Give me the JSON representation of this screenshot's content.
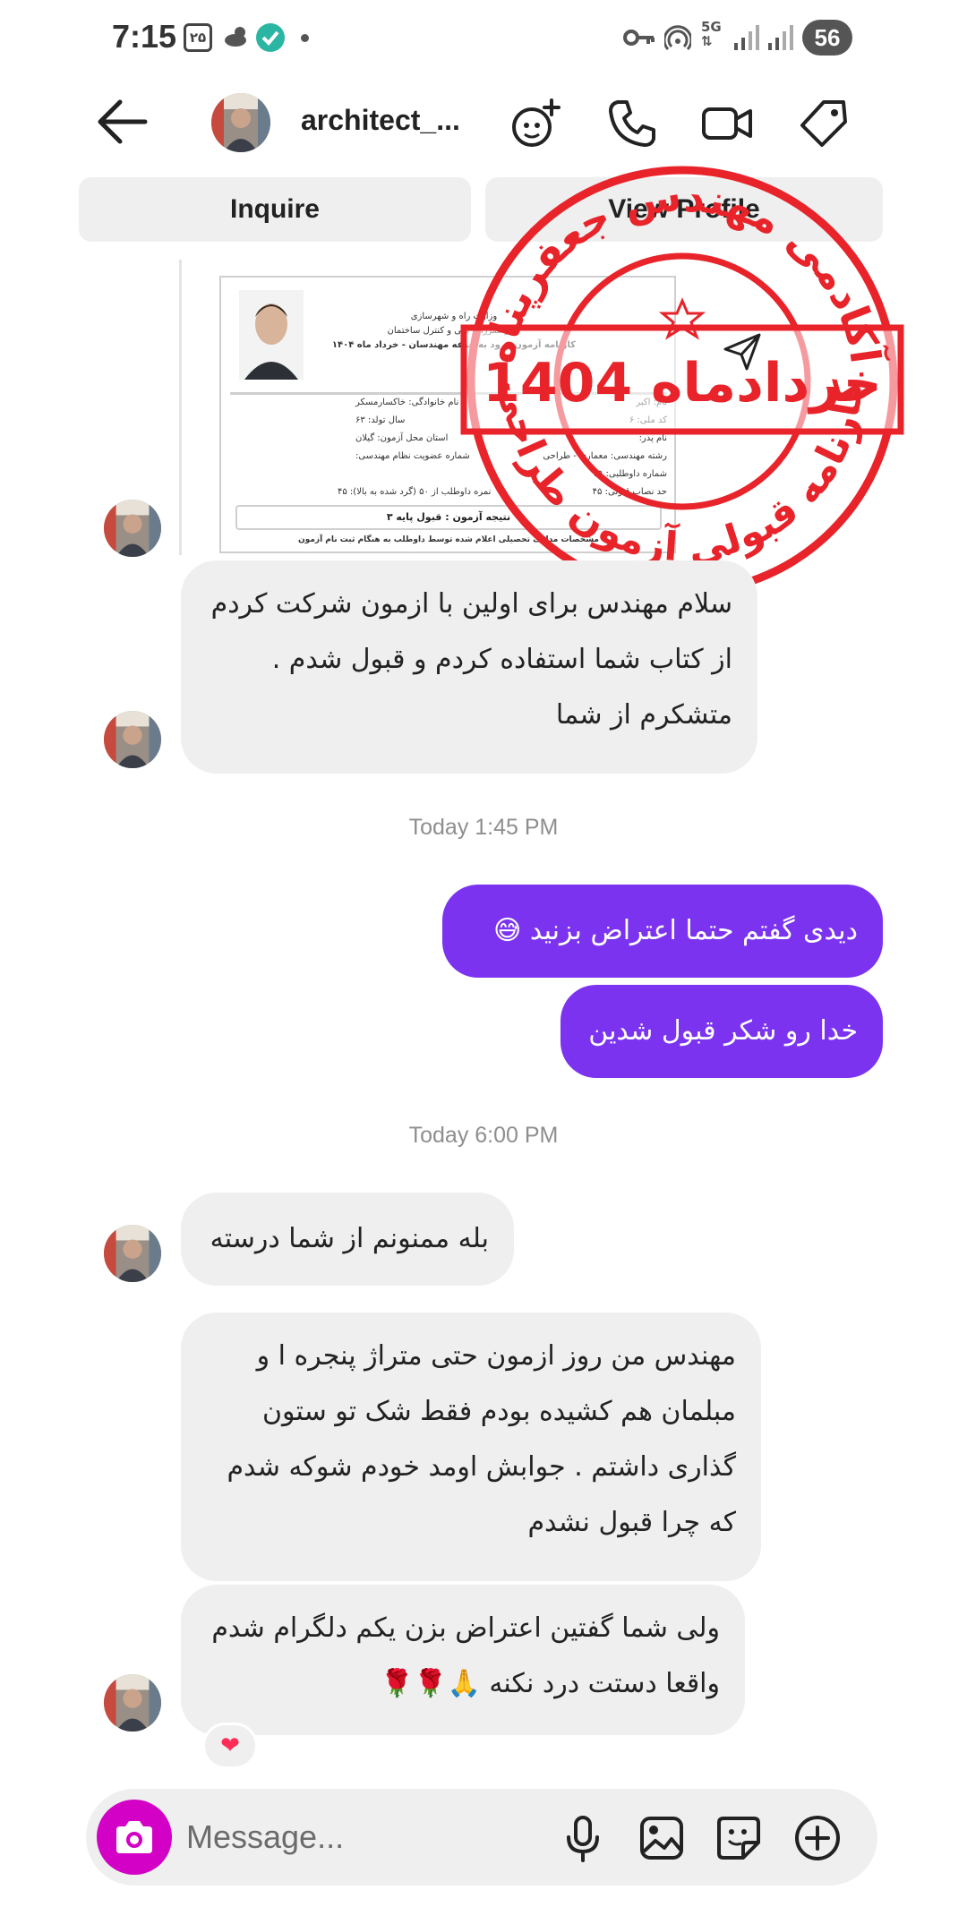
{
  "status_bar": {
    "time": "7:15",
    "badge": "۲۵",
    "network": "5G",
    "battery": "56"
  },
  "header": {
    "username": "architect_...",
    "icons": [
      "back-arrow-icon",
      "ai-sparkle-icon",
      "phone-icon",
      "video-icon",
      "tag-icon"
    ]
  },
  "actions": {
    "inquire": "Inquire",
    "view_profile": "View Profile"
  },
  "messages": {
    "m1": {
      "line1": "سلام مهندس برای اولین با ازمون شرکت کردم",
      "line2": "از کتاب شما استفاده کردم و قبول شدم .",
      "line3": "متشکرم از شما"
    },
    "ts1": "Today 1:45 PM",
    "o1": "دیدی گفتم حتما اعتراض بزنید 😅",
    "o2": "خدا رو شکر قبول شدین",
    "ts2": "Today 6:00 PM",
    "m2": "بله ممنونم از شما  درسته",
    "m3": {
      "line1": "مهندس من روز ازمون حتی متراژ پنجره  ا و",
      "line2": "مبلمان هم کشیده بودم فقط شک تو ستون",
      "line3": "گذاری داشتم . جوابش اومد خودم شوکه شدم",
      "line4": "که چرا قبول نشدم"
    },
    "m4": {
      "line1": "ولی شما گفتین اعتراض بزن یکم دلگرام شدم",
      "line2": "واقعا دستت درد نکنه 🙏🌹🌹"
    },
    "reaction": "❤"
  },
  "document": {
    "line1": "وزارت راه و شهرسازی",
    "line2": "دفتر مقررات ملی و کنترل ساختمان",
    "line3": "کارنامه آزمون ورود به حرفه مهندسان - خرداد ماه ۱۴۰۴",
    "name": "نام: اکبر",
    "family": "نام خانوادگی: خاکسارمسکر",
    "code": "کد ملی: ۶",
    "birth": "سال تولد: ۶۳",
    "father": "نام پدر:",
    "place": "استان محل آزمون: گیلان",
    "field": "رشته مهندسی: معماری - طراحی",
    "member": "شماره عضویت نظام مهندسی:",
    "seat": "شماره داوطلبی: ۲۹",
    "min": "حد نصاب قبولی: ۴۵",
    "score": "نمره داوطلب از ۵۰ (گرد شده به بالا): ۴۵",
    "result": "نتیجه آزمون : قبول پایه ۳",
    "note": "مشخصات مدارک تحصیلی اعلام شده توسط داوطلب به هنگام ثبت نام آزمون"
  },
  "stamp": {
    "top_text": "آکادمی مهندس جعفرپناه",
    "middle_text": "خردادماه 1404",
    "bottom_text": "کارنامه قبولی آزمون طراحی",
    "color": "#e8232a"
  },
  "composer": {
    "placeholder": "Message...",
    "accent": "#d300c5"
  },
  "colors": {
    "outgoing_bubble": "#7b33f0",
    "incoming_bubble": "#efefef"
  }
}
